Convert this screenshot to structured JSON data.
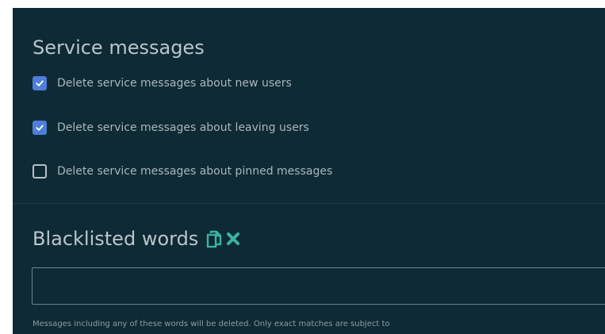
{
  "service_messages": {
    "title": "Service messages",
    "options": [
      {
        "label": "Delete service messages about new users",
        "checked": true
      },
      {
        "label": "Delete service messages about leaving users",
        "checked": true
      },
      {
        "label": "Delete service messages about pinned messages",
        "checked": false
      }
    ]
  },
  "blacklisted_words": {
    "title": "Blacklisted words",
    "icons": [
      "copy-icon",
      "clear-icon"
    ],
    "input_value": "",
    "help_text": "Messages including any of these words will be deleted. Only exact matches are subject to"
  },
  "colors": {
    "panel_background": "#0e2a35",
    "accent": "#4f7ed9",
    "icon_teal": "#3bb3a0",
    "title_text": "#b9c6cc"
  }
}
